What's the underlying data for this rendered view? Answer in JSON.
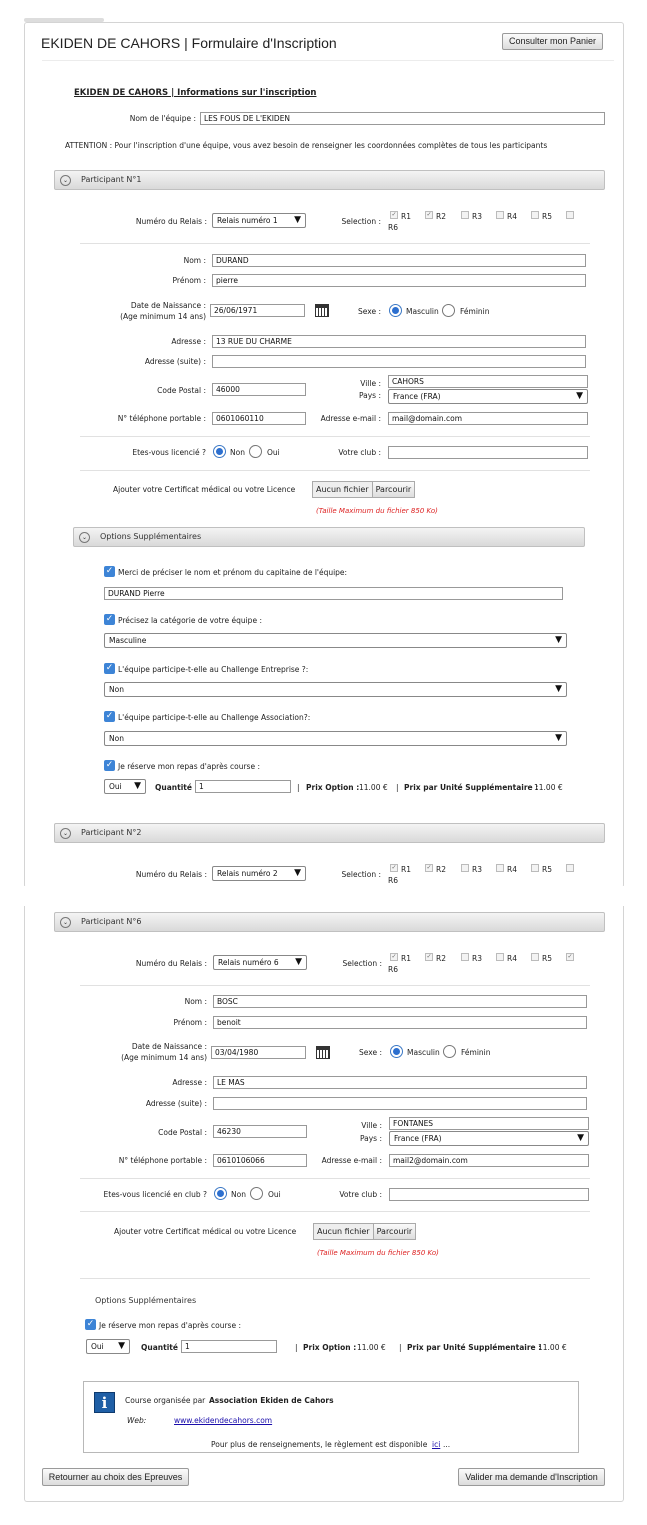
{
  "window": {
    "title": "EKIDEN DE CAHORS | Formulaire d'Inscription",
    "cart_button": "Consulter mon Panier"
  },
  "header": {
    "section_title": "EKIDEN DE CAHORS | Informations sur l'inscription",
    "team_label": "Nom de l'équipe :",
    "team_value": "LES FOUS DE L'EKIDEN",
    "attention": "ATTENTION : Pour l'inscription d'une équipe, vous avez besoin de renseigner les coordonnées complètes de tous les participants"
  },
  "labels": {
    "relay": "Numéro du Relais :",
    "selection": "Selection :",
    "r1": "R1",
    "r2": "R2",
    "r3": "R3",
    "r4": "R4",
    "r5": "R5",
    "r6": "R6",
    "nom": "Nom :",
    "prenom": "Prénom :",
    "dob": "Date de Naissance :",
    "dob_note": "(Age minimum 14 ans)",
    "sexe": "Sexe :",
    "masculin": "Masculin",
    "feminin": "Féminin",
    "adresse": "Adresse :",
    "adresse2": "Adresse (suite) :",
    "cp": "Code Postal :",
    "ville": "Ville :",
    "pays": "Pays :",
    "tel": "N° téléphone portable :",
    "email": "Adresse e-mail :",
    "licence_q1": "Etes-vous licencié ?",
    "licence_q6": "Etes-vous licencié en club ?",
    "non": "Non",
    "oui": "Oui",
    "club": "Votre club :",
    "cert": "Ajouter votre Certificat médical ou votre Licence",
    "no_file": "Aucun fichier",
    "browse": "Parcourir",
    "max_size": "(Taille Maximum du fichier 850 Ko)",
    "options": "Options Supplémentaires",
    "opt_captain": "Merci de préciser le nom et prénom du capitaine de l'équipe:",
    "opt_category": "Précisez la catégorie de votre équipe :",
    "opt_entreprise": "L'équipe participe-t-elle au Challenge Entreprise ?:",
    "opt_association": "L'équipe participe-t-elle au Challenge Association?:",
    "opt_repas": "Je réserve mon repas d'après course :",
    "quantite": "Quantité :",
    "prix_option": "Prix Option :",
    "prix_option_val": "11.00 €",
    "prix_unite": "Prix par Unité Supplémentaire :",
    "prix_unite_val": "11.00 €",
    "sep": "|"
  },
  "participant1": {
    "title": "Participant N°1",
    "relay": "Relais numéro 1",
    "nom": "DURAND",
    "prenom": "pierre",
    "dob": "26/06/1971",
    "adresse": "13 RUE DU CHARME",
    "adresse2": "",
    "cp": "46000",
    "ville": "CAHORS",
    "pays": "France (FRA)",
    "tel": "0601060110",
    "email": "mail@domain.com",
    "club": "",
    "captain": "DURAND Pierre",
    "category": "Masculine",
    "entreprise": "Non",
    "association": "Non",
    "repas": "Oui",
    "quantite": "1"
  },
  "participant2": {
    "title": "Participant N°2",
    "relay": "Relais numéro 2"
  },
  "participant6": {
    "title": "Participant N°6",
    "relay": "Relais numéro 6",
    "nom": "BOSC",
    "prenom": "benoit",
    "dob": "03/04/1980",
    "adresse": "LE MAS",
    "adresse2": "",
    "cp": "46230",
    "ville": "FONTANES",
    "pays": "France (FRA)",
    "tel": "0610106066",
    "email": "mail2@domain.com",
    "club": "",
    "repas": "Oui",
    "quantite": "1"
  },
  "footer": {
    "org_prefix": "Course organisée par",
    "org_name": "Association Ekiden de Cahors",
    "web_label": "Web:",
    "web_link": "www.ekidendecahors.com",
    "info_text": "Pour plus de renseignements, le règlement est disponible",
    "info_link": "ici",
    "info_suffix": "...",
    "back_button": "Retourner au choix des Epreuves",
    "submit_button": "Valider ma demande d'Inscription"
  }
}
